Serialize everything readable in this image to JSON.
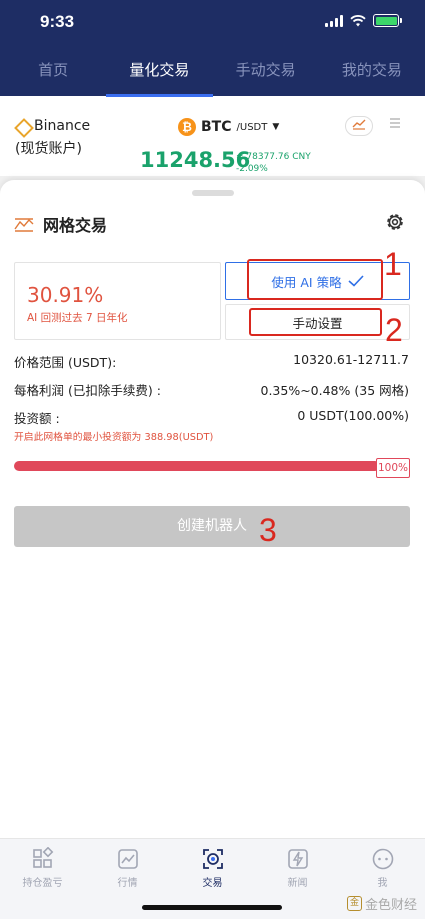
{
  "status": {
    "time": "9:33"
  },
  "nav_tabs": [
    {
      "label": "首页"
    },
    {
      "label": "量化交易"
    },
    {
      "label": "手动交易"
    },
    {
      "label": "我的交易"
    }
  ],
  "market": {
    "exchange_name": "Binance",
    "account_type": "(现货账户)",
    "base": "BTC",
    "quote": "/USDT",
    "price": "11248.56",
    "price_cny": "≈ 78377.76 CNY",
    "change": "-2.09%",
    "btc_glyph": "₿"
  },
  "sheet": {
    "title": "网格交易",
    "ai_return": "30.91%",
    "ai_note": "AI 回测过去 7 日年化",
    "use_ai_label": "使用 AI 策略",
    "manual_label": "手动设置",
    "price_range_label": "价格范围 (USDT):",
    "price_range_value": "10320.61-12711.7",
    "profit_label": "每格利润 (已扣除手续费) :",
    "profit_value": "0.35%~0.48% (35 网格)",
    "invest_label": "投资额 :",
    "invest_value": "0 USDT(100.00%)",
    "min_invest_note": "开启此网格单的最小投资额为 388.98(USDT)",
    "slider_percent": 100,
    "slider_label": "100%",
    "create_label": "创建机器人"
  },
  "annotations": [
    "1",
    "2",
    "3"
  ],
  "bottom_nav": [
    {
      "label": "持仓盈亏",
      "icon": "holdings-icon"
    },
    {
      "label": "行情",
      "icon": "chart-icon"
    },
    {
      "label": "交易",
      "icon": "trade-icon"
    },
    {
      "label": "新闻",
      "icon": "news-icon"
    },
    {
      "label": "我",
      "icon": "profile-icon"
    }
  ],
  "watermark": "金色财经",
  "colors": {
    "header_bg": "#1e2d64",
    "accent_blue": "#2f6fe6",
    "up_green": "#1aa26b",
    "red": "#e0533f",
    "annotation_red": "#d9281f"
  }
}
